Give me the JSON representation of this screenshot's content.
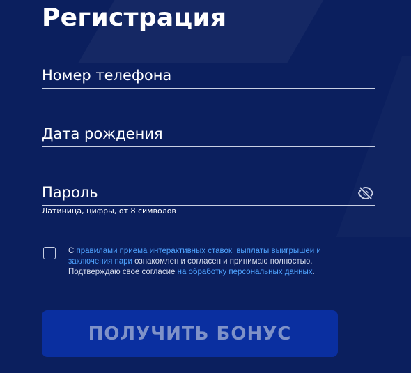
{
  "form": {
    "title": "Регистрация",
    "phone": {
      "value": "",
      "placeholder": "Номер телефона"
    },
    "birthdate": {
      "value": "",
      "placeholder": "Дата рождения"
    },
    "password": {
      "value": "",
      "placeholder": "Пароль",
      "hint": "Латиница, цифры, от 8 символов",
      "toggle_icon": "eye-off-icon"
    },
    "agreement": {
      "checked": false,
      "text_prefix": "С ",
      "link_rules": "правилами приема интерактивных ставок, выплаты выигрышей и заключения пари",
      "text_mid": " ознакомлен и согласен и принимаю полностью. Подтверждаю свое согласие ",
      "link_data": "на обработку персональных данных",
      "text_suffix": "."
    },
    "submit_label": "ПОЛУЧИТЬ БОНУС"
  },
  "colors": {
    "background": "#0b1f5e",
    "link": "#4fa3ff",
    "button_bg": "#0a2fa0",
    "button_text": "#7f92c8"
  }
}
